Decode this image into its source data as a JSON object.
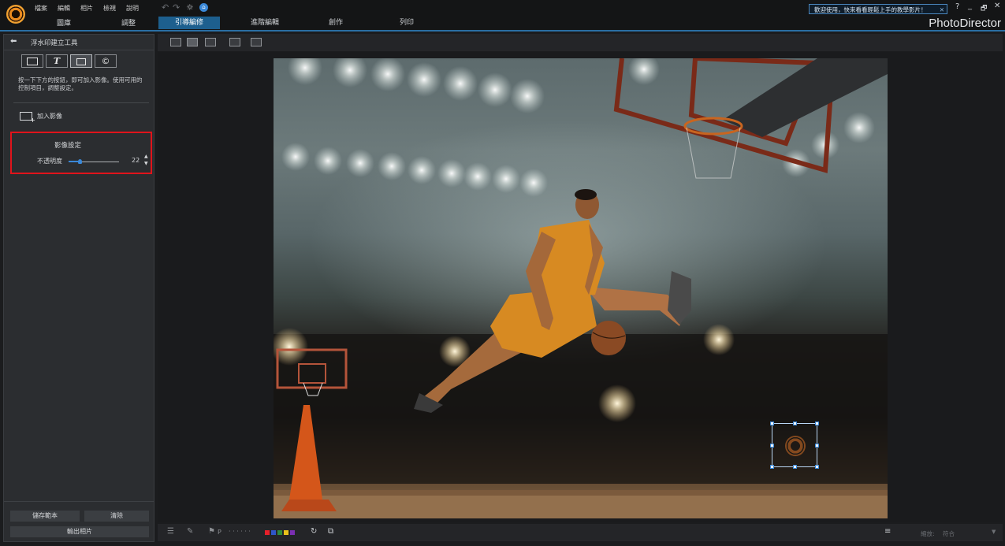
{
  "menu": [
    "檔案",
    "編輯",
    "相片",
    "檢視",
    "說明"
  ],
  "modules": [
    "圖庫",
    "調整"
  ],
  "edit_tabs": [
    "引導編修",
    "進階編輯",
    "創作",
    "列印"
  ],
  "welcome": {
    "text": "歡迎使用，快來看看輕鬆上手的教學影片！",
    "close": "✕"
  },
  "brand": "PhotoDirector",
  "window_controls": {
    "help": "?",
    "minimize": "_",
    "maximize": "🗗",
    "close": "✕"
  },
  "panel": {
    "title": "浮水印建立工具",
    "tools": [
      "rectangle",
      "text",
      "image",
      "copyright"
    ],
    "tool_text_glyph": "T",
    "tool_copyright_glyph": "©",
    "instructions": "按一下下方的按鈕，即可加入影像。使用可用的控制項目，調整設定。",
    "add_image": "加入影像",
    "settings_title": "影像設定",
    "opacity_label": "不透明度",
    "opacity_value": "22",
    "opacity_percent": 22,
    "save_template": "儲存範本",
    "clear": "清除",
    "export": "輸出相片"
  },
  "bottom": {
    "zoom_label": "縮放:",
    "zoom_value": "符合",
    "flag_label": "P",
    "dots": "· · · · · ·",
    "color_labels": [
      "#e5202a",
      "#2f56c9",
      "#2e8a3c",
      "#e8c21b",
      "#7b2fb2"
    ]
  },
  "colors": {
    "accent": "#1d5f8e",
    "highlight_red": "#e0141b",
    "selection_blue": "#3a88d8"
  }
}
